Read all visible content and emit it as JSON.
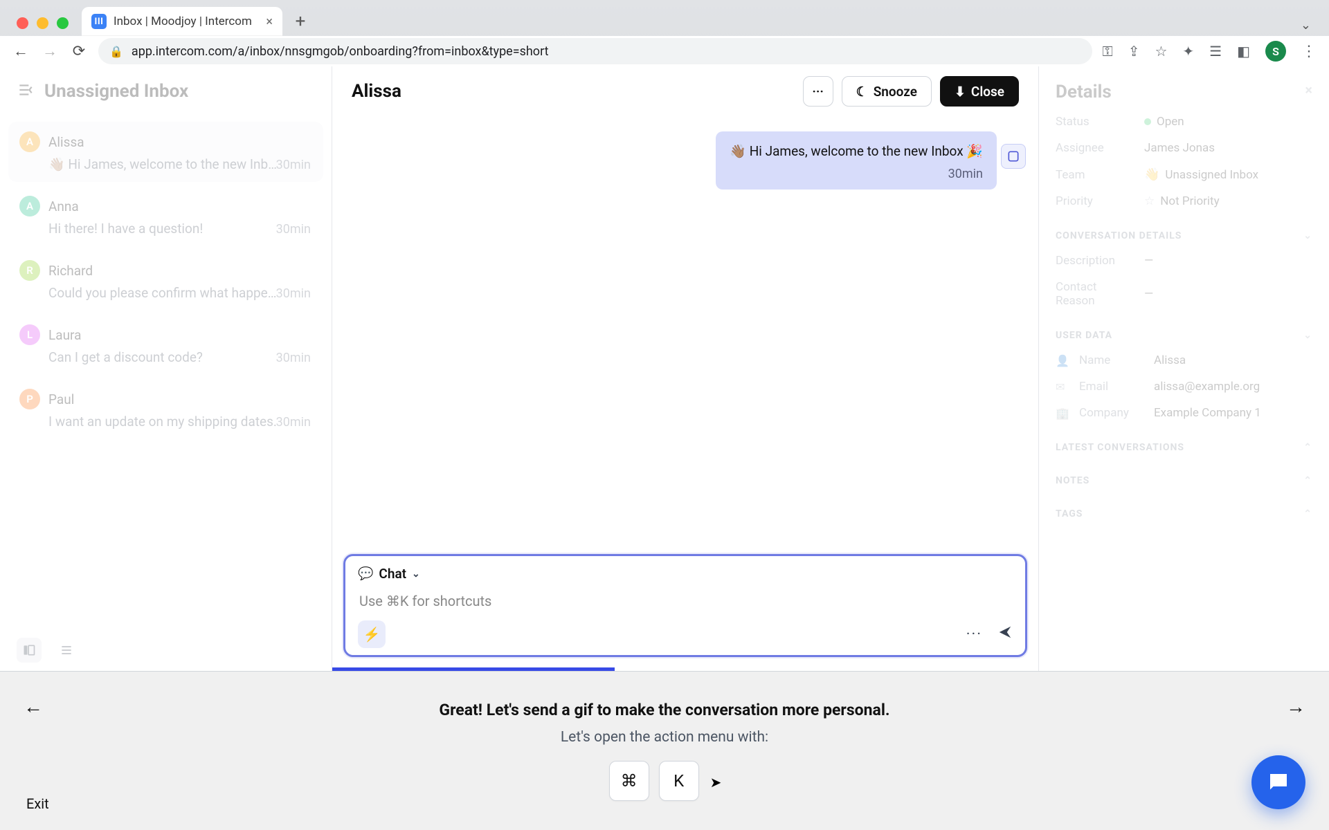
{
  "browser": {
    "tab_title": "Inbox | Moodjoy | Intercom",
    "tab_favicon_letters": "III",
    "url": "app.intercom.com/a/inbox/nnsgmgob/onboarding?from=inbox&type=short",
    "profile_initial": "S"
  },
  "inbox": {
    "title": "Unassigned Inbox",
    "items": [
      {
        "initial": "A",
        "color": "#f59e0b",
        "name": "Alissa",
        "preview": "👋🏽 Hi James, welcome to the new Inb…",
        "time": "30min",
        "active": true
      },
      {
        "initial": "A",
        "color": "#10b981",
        "name": "Anna",
        "preview": "Hi there! I have a question!",
        "time": "30min",
        "active": false
      },
      {
        "initial": "R",
        "color": "#84cc16",
        "name": "Richard",
        "preview": "Could you please confirm what happe…",
        "time": "30min",
        "active": false
      },
      {
        "initial": "L",
        "color": "#d946ef",
        "name": "Laura",
        "preview": "Can I get a discount code?",
        "time": "30min",
        "active": false
      },
      {
        "initial": "P",
        "color": "#f97316",
        "name": "Paul",
        "preview": "I want an update on my shipping dates.",
        "time": "30min",
        "active": false
      }
    ]
  },
  "conversation": {
    "title": "Alissa",
    "snooze_label": "Snooze",
    "close_label": "Close",
    "more_label": "···",
    "message_text": "👋🏽 Hi James, welcome to the new Inbox 🎉",
    "message_time": "30min",
    "composer_mode": "Chat",
    "composer_placeholder": "Use ⌘K for shortcuts"
  },
  "details": {
    "title": "Details",
    "status_k": "Status",
    "status_v": "Open",
    "assignee_k": "Assignee",
    "assignee_v": "James Jonas",
    "team_k": "Team",
    "team_v": "Unassigned Inbox",
    "priority_k": "Priority",
    "priority_v": "Not Priority",
    "sec_conv": "CONVERSATION DETAILS",
    "desc_k": "Description",
    "desc_v": "—",
    "reason_k": "Contact Reason",
    "reason_v": "—",
    "sec_user": "USER DATA",
    "name_k": "Name",
    "name_v": "Alissa",
    "email_k": "Email",
    "email_v": "alissa@example.org",
    "company_k": "Company",
    "company_v": "Example Company 1",
    "sec_latest": "LATEST CONVERSATIONS",
    "sec_notes": "NOTES",
    "sec_tags": "TAGS"
  },
  "onboard": {
    "headline": "Great! Let's send a gif to make the conversation more personal.",
    "sub": "Let's open the action menu with:",
    "key1": "⌘",
    "key2": "K",
    "exit": "Exit"
  }
}
